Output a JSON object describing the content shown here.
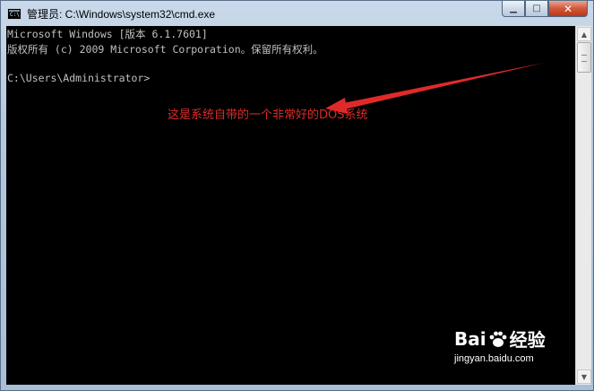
{
  "window": {
    "title": "管理员: C:\\Windows\\system32\\cmd.exe",
    "icon_text": "C:\\"
  },
  "controls": {
    "minimize": "▁",
    "maximize": "□",
    "close": "✕"
  },
  "console": {
    "lines": [
      "Microsoft Windows [版本 6.1.7601]",
      "版权所有 (c) 2009 Microsoft Corporation。保留所有权利。",
      "",
      "C:\\Users\\Administrator>"
    ]
  },
  "annotation": {
    "text": "这是系统自带的一个非常好的DOS系统",
    "color": "#e02a2a"
  },
  "watermark": {
    "logo_left": "Bai",
    "logo_right": "经验",
    "url": "jingyan.baidu.com"
  },
  "colors": {
    "console_bg": "#000000",
    "console_fg": "#c0c0c0",
    "close_button": "#c7442a"
  }
}
